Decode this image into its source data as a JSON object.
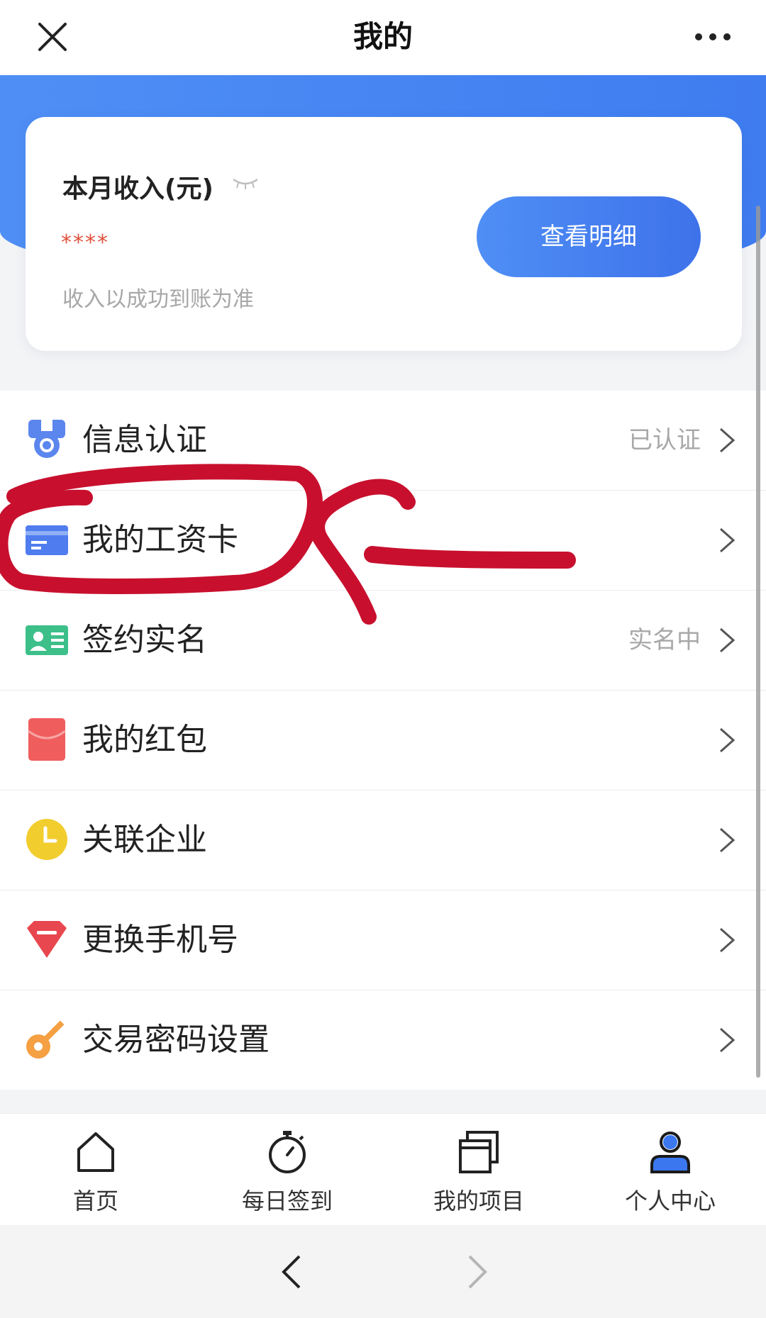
{
  "header": {
    "title": "我的",
    "close_icon": "close-icon",
    "more_icon": "more-icon"
  },
  "income": {
    "title": "本月收入(元)",
    "masked_value": "****",
    "note": "收入以成功到账为准",
    "detail_button": "查看明细",
    "masked_color": "#e0523d"
  },
  "menu": {
    "items": [
      {
        "label": "信息认证",
        "status": "已认证",
        "icon": "badge-icon"
      },
      {
        "label": "我的工资卡",
        "status": "",
        "icon": "card-icon"
      },
      {
        "label": "签约实名",
        "status": "实名中",
        "icon": "id-card-icon"
      },
      {
        "label": "我的红包",
        "status": "",
        "icon": "red-envelope-icon"
      },
      {
        "label": "关联企业",
        "status": "",
        "icon": "clock-icon"
      },
      {
        "label": "更换手机号",
        "status": "",
        "icon": "diamond-icon"
      },
      {
        "label": "交易密码设置",
        "status": "",
        "icon": "key-icon"
      }
    ]
  },
  "tabs": [
    {
      "label": "首页",
      "icon": "home-icon"
    },
    {
      "label": "每日签到",
      "icon": "stopwatch-icon"
    },
    {
      "label": "我的项目",
      "icon": "projects-icon"
    },
    {
      "label": "个人中心",
      "icon": "user-icon",
      "active": true
    }
  ],
  "colors": {
    "accent": "#4584f2",
    "annotation": "#c8102e"
  }
}
